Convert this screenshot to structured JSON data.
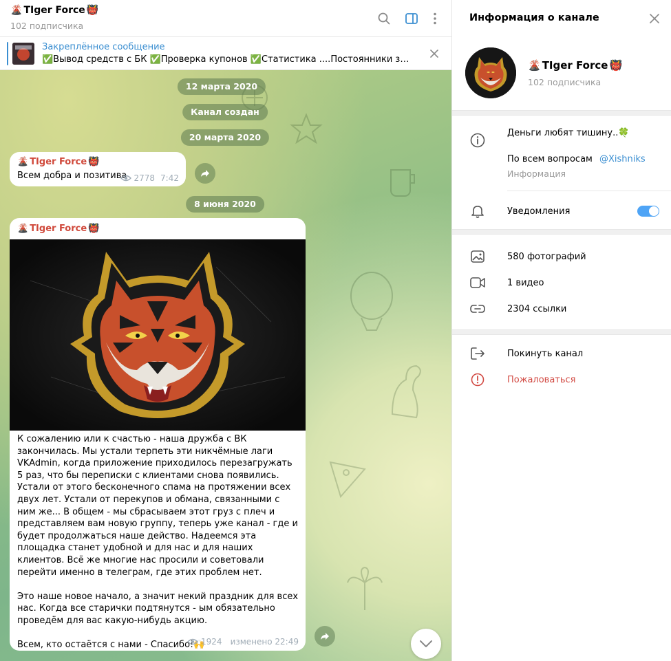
{
  "header": {
    "emoji_prefix": "🌋",
    "title": "TIger Force",
    "emoji_suffix": "👹",
    "subtitle": "102 подписчика"
  },
  "pinned": {
    "title": "Закреплённое сообщение",
    "text": "✅Вывод средств с БК ✅Проверка купонов ✅Статистика  ....Постоянники знают, к..."
  },
  "dates": {
    "d1": "12 марта 2020",
    "created": "Канал создан",
    "d2": "20 марта 2020",
    "d3": "8 июня 2020"
  },
  "message1": {
    "author": "TIger Force",
    "text": "Всем добра и позитива",
    "views": "2778",
    "time": "7:42"
  },
  "message2": {
    "author": "TIger Force",
    "text": "К сожалению или к счастью - наша дружба с ВК закончилась. Мы устали терпеть эти никчёмные лаги VKAdmin, когда приложение приходилось перезагружать 5 раз, что бы переписки с клиентами снова появились. Устали от этого бесконечного спама на протяжении всех двух лет. Устали от перекупов и обмана, связанными с ним же... В общем - мы сбрасываем этот груз с плеч и представляем вам новую группу, теперь уже канал - где и будет продолжаться наше действо. Надеемся эта площадка станет удобной и для нас и для наших клиентов. Всё же многие нас просили и советовали перейти именно в телеграм, где этих проблем нет.\n\nЭто наше новое начало, а значит некий праздник для всех нас. Когда все старички подтянутся - ым обязательно проведём для вас какую-нибудь акцию.\n\nВсем, кто остаётся с нами - Спасибо!🙌",
    "views": "1924",
    "edited_time": "изменено 22:49"
  },
  "info": {
    "panel_title": "Информация о канале",
    "name": "TIger Force",
    "subs": "102 подписчика",
    "description": "Деньги любят тишину..🍀",
    "contact_prefix": "По всем вопросам",
    "contact_link": "@Xishniks",
    "description_caption": "Информация",
    "notifications": "Уведомления",
    "notifications_on": true,
    "photos": "580 фотографий",
    "videos": "1 видео",
    "links": "2304 ссылки",
    "leave": "Покинуть канал",
    "report": "Пожаловаться"
  },
  "colors": {
    "accent": "#3a8ed1",
    "author": "#d0493b",
    "toggle": "#4ea4f6",
    "report": "#d24a43"
  }
}
